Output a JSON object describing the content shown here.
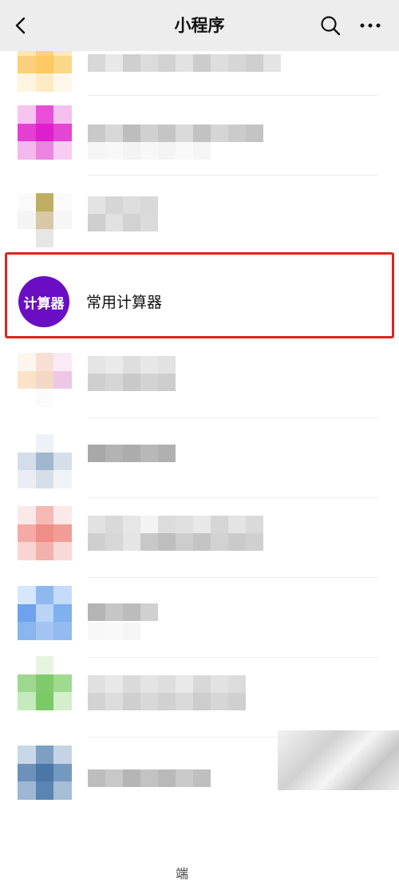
{
  "header": {
    "title": "小程序",
    "back_icon": "chevron-left-icon",
    "search_icon": "search-icon",
    "more_icon": "more-horizontal-icon",
    "background": "#ededed"
  },
  "highlighted_app": {
    "icon_text": "计算器",
    "name": "常用计算器",
    "icon_color": "#6a0ec4",
    "highlight_color": "#d8271f"
  },
  "truncated_text": "端"
}
